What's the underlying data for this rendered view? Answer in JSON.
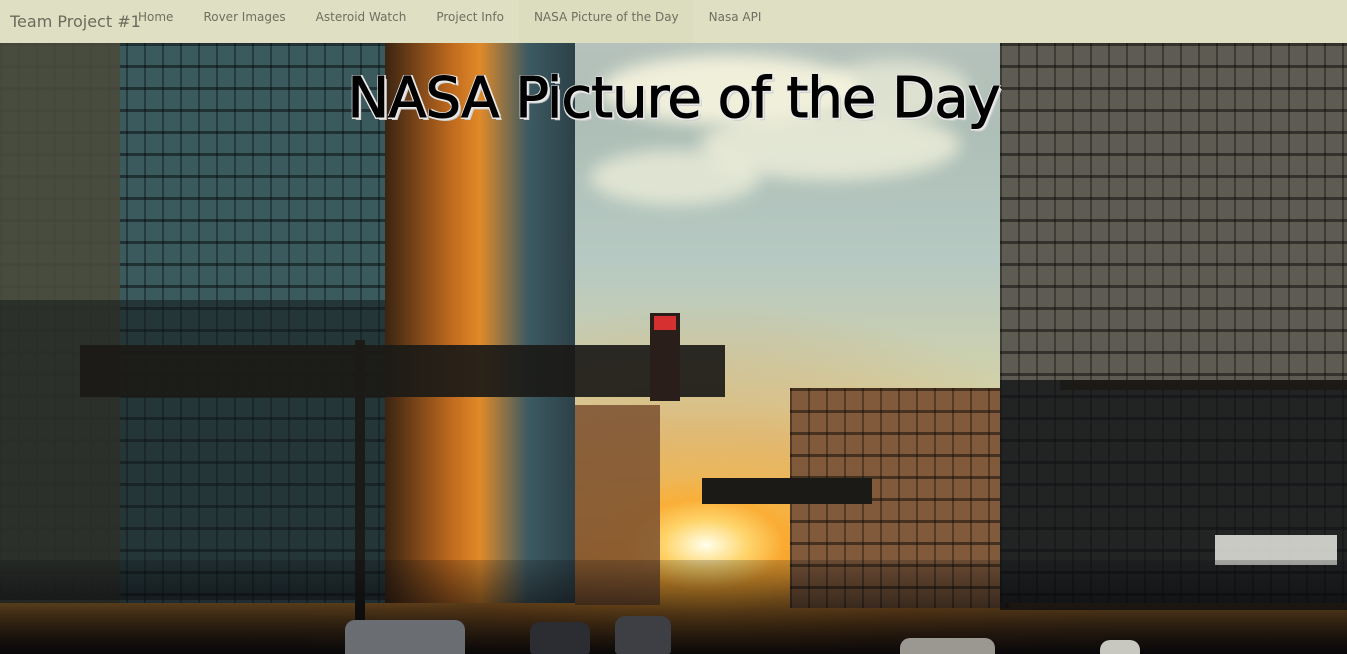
{
  "navbar": {
    "brand": "Team Project #1",
    "items": [
      {
        "label": "Home"
      },
      {
        "label": "Rover Images"
      },
      {
        "label": "Asteroid Watch"
      },
      {
        "label": "Project Info"
      },
      {
        "label": "NASA Picture of the Day",
        "active": true
      },
      {
        "label": "Nasa API"
      }
    ]
  },
  "hero": {
    "title": "NASA Picture of the Day",
    "image_description_icon": "city-sunset-photo"
  },
  "colors": {
    "navbar_bg": "#e8e6c4",
    "nav_text": "#6f6e60",
    "title_text": "#000000"
  }
}
